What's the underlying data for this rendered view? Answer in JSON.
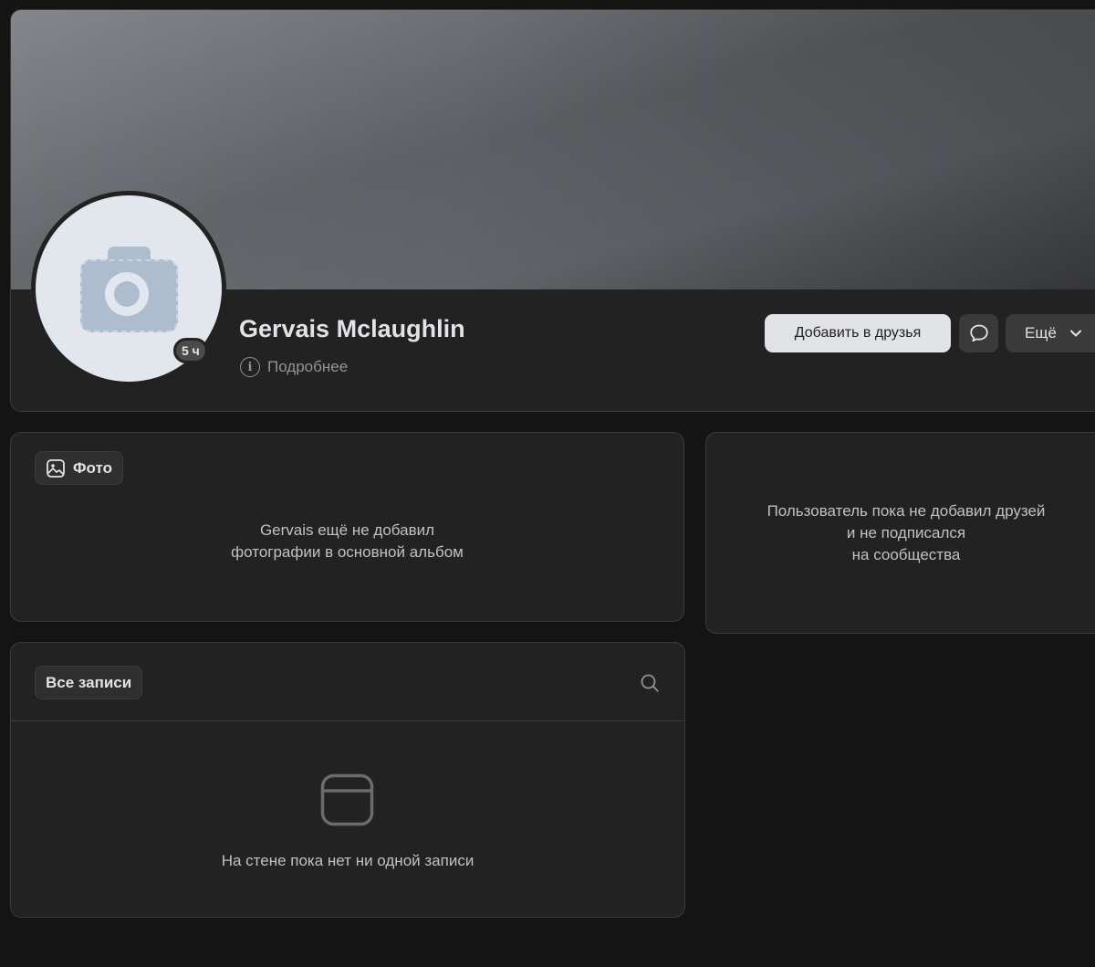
{
  "profile": {
    "name": "Gervais Mclaughlin",
    "last_seen": "5 ч",
    "details_label": "Подробнее",
    "actions": {
      "add_friend": "Добавить в друзья",
      "more": "Ещё"
    }
  },
  "photos": {
    "chip_label": "Фото",
    "empty_line1": "Gervais ещё не добавил",
    "empty_line2": "фотографии в основной альбом"
  },
  "friends": {
    "empty_line1": "Пользователь пока не добавил друзей",
    "empty_line2": "и не подписался",
    "empty_line3": "на сообщества"
  },
  "wall": {
    "filter_label": "Все записи",
    "empty_text": "На стене пока нет ни одной записи"
  },
  "icons": {
    "details": "info-icon",
    "message": "message-bubble-icon",
    "more": "chevron-down-icon",
    "photo": "image-icon",
    "search": "search-icon",
    "wall_empty": "post-icon"
  }
}
